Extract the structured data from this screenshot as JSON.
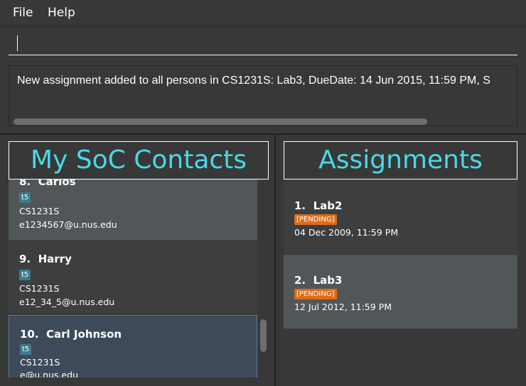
{
  "menu": {
    "file": "File",
    "help": "Help"
  },
  "command": {
    "value": "",
    "placeholder": ""
  },
  "result": {
    "text": "New assignment added to all persons in CS1231S: Lab3, DueDate: 14 Jun 2015, 11:59 PM, S"
  },
  "left_panel": {
    "title": "My SoC Contacts",
    "persons": [
      {
        "index": "8.",
        "name": "Carlos",
        "tag": "t5",
        "module": "CS1231S",
        "email": "e1234567@u.nus.edu"
      },
      {
        "index": "9.",
        "name": "Harry",
        "tag": "t5",
        "module": "CS1231S",
        "email": "e12_34_5@u.nus.edu"
      },
      {
        "index": "10.",
        "name": "Carl Johnson",
        "tag": "t5",
        "module": "CS1231S",
        "email": "e@u.nus.edu"
      }
    ]
  },
  "right_panel": {
    "title": "Assignments",
    "assignments": [
      {
        "index": "1.",
        "name": "Lab2",
        "status": "[PENDING]",
        "due": "04 Dec 2009, 11:59 PM"
      },
      {
        "index": "2.",
        "name": "Lab3",
        "status": "[PENDING]",
        "due": "12 Jul 2012, 11:59 PM"
      }
    ]
  },
  "colors": {
    "background": "#383838",
    "title_accent": "#4ad8e6",
    "tag": "#3e7b91",
    "pending": "#e16b16"
  }
}
